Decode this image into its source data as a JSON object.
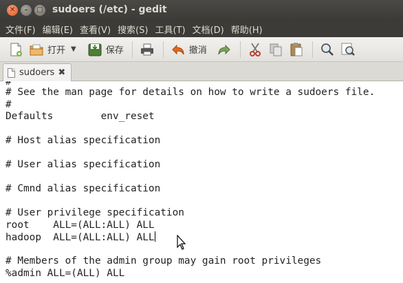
{
  "window": {
    "title": "sudoers (/etc) - gedit",
    "close_glyph": "✕",
    "min_glyph": "–",
    "max_glyph": "□"
  },
  "menu": [
    "文件(F)",
    "编辑(E)",
    "查看(V)",
    "搜索(S)",
    "工具(T)",
    "文档(D)",
    "帮助(H)"
  ],
  "toolbar": {
    "open_label": "打开",
    "save_label": "保存",
    "undo_label": "撤消"
  },
  "tab": {
    "title": "sudoers",
    "close_glyph": "✖"
  },
  "editor": {
    "lines": [
      "#",
      "# See the man page for details on how to write a sudoers file.",
      "#",
      "Defaults        env_reset",
      "",
      "# Host alias specification",
      "",
      "# User alias specification",
      "",
      "# Cmnd alias specification",
      "",
      "# User privilege specification",
      "root    ALL=(ALL:ALL) ALL",
      "hadoop  ALL=(ALL:ALL) ALL",
      "",
      "# Members of the admin group may gain root privileges",
      "%admin ALL=(ALL) ALL"
    ]
  }
}
